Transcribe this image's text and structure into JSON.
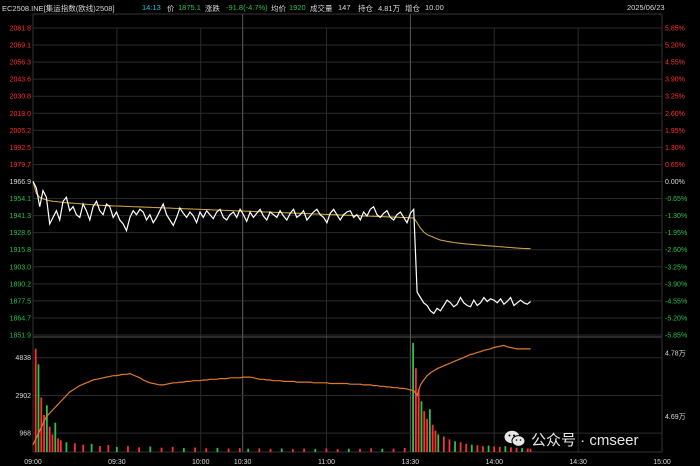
{
  "header": {
    "symbol": "EC2508.INE[集运指数(欧线)2508]",
    "time": "14:13",
    "price_label": "价",
    "price": "1875.1",
    "change_label": "涨跌",
    "change": "-91.8(-4.7%)",
    "avg_label": "均价",
    "avg": "1920",
    "volume_label": "成交量",
    "volume": "147",
    "oi_label": "持仓",
    "oi": "4.81万",
    "oi_chg_label": "增仓",
    "oi_chg": "10.00",
    "date": "2025/06/23"
  },
  "price_ticks": [
    "2081.8",
    "2069.1",
    "2056.3",
    "2043.6",
    "2030.8",
    "2018.0",
    "2005.2",
    "1992.5",
    "1979.7",
    "1966.9",
    "1954.1",
    "1941.3",
    "1928.6",
    "1915.8",
    "1903.0",
    "1890.2",
    "1877.5",
    "1864.7",
    "1851.9"
  ],
  "pct_ticks": [
    "5.85%",
    "5.20%",
    "4.55%",
    "3.90%",
    "3.25%",
    "2.60%",
    "1.95%",
    "1.30%",
    "0.65%",
    "0.00%",
    "-0.65%",
    "-1.30%",
    "-1.95%",
    "-2.60%",
    "-3.25%",
    "-3.90%",
    "-4.55%",
    "-5.20%",
    "-5.85%"
  ],
  "volume_ticks": [
    "4838",
    "2902",
    "968"
  ],
  "oi_ticks": [
    "4.78万",
    "4.69万"
  ],
  "time_ticks": [
    "09:00",
    "09:30",
    "10:00",
    "10:30",
    "11:00",
    "13:30",
    "14:00",
    "14:30",
    "15:00"
  ],
  "colors": {
    "up": "#ff3030",
    "down": "#27c24c",
    "flat": "#d8d8d8",
    "price_line": "#ffffff",
    "avg_line": "#c8a040",
    "oi_line": "#e07a2a",
    "grid": "#2a2a2a"
  },
  "chart_data": {
    "type": "line",
    "price_range": [
      1851.9,
      2081.8
    ],
    "prev_settle": 1966.9,
    "price_series": [
      1966.9,
      1962,
      1948,
      1960,
      1955,
      1935,
      1940,
      1945,
      1938,
      1952,
      1955,
      1945,
      1948,
      1942,
      1940,
      1950,
      1945,
      1938,
      1948,
      1952,
      1945,
      1942,
      1950,
      1948,
      1940,
      1944,
      1938,
      1935,
      1930,
      1940,
      1945,
      1942,
      1946,
      1944,
      1938,
      1942,
      1936,
      1940,
      1945,
      1950,
      1942,
      1938,
      1934,
      1940,
      1947,
      1943,
      1940,
      1944,
      1941,
      1936,
      1944,
      1940,
      1945,
      1942,
      1939,
      1944,
      1946,
      1940,
      1938,
      1942,
      1944,
      1940,
      1946,
      1942,
      1937,
      1944,
      1940,
      1943,
      1946,
      1941,
      1938,
      1944,
      1942,
      1940,
      1945,
      1941,
      1938,
      1943,
      1946,
      1940,
      1942,
      1945,
      1938,
      1941,
      1944,
      1946,
      1942,
      1940,
      1936,
      1943,
      1946,
      1942,
      1938,
      1942,
      1944,
      1945,
      1940,
      1942,
      1938,
      1944,
      1941,
      1946,
      1948,
      1942,
      1940,
      1943,
      1945,
      1940,
      1938,
      1942,
      1944,
      1940,
      1936,
      1943,
      1946,
      1884,
      1880,
      1876,
      1874,
      1870,
      1868,
      1872,
      1870,
      1874,
      1878,
      1876,
      1873,
      1875,
      1880,
      1876,
      1874,
      1873,
      1878,
      1874,
      1876,
      1880,
      1877,
      1879,
      1878,
      1876,
      1879,
      1875,
      1877,
      1880,
      1874,
      1876,
      1878,
      1876,
      1875,
      1877
    ],
    "avg_series": [
      1966.9,
      1958,
      1955,
      1954,
      1953,
      1952.5,
      1952,
      1951.8,
      1951.5,
      1951.2,
      1951,
      1950.8,
      1950.6,
      1950.4,
      1950.2,
      1950,
      1949.8,
      1949.6,
      1949.4,
      1949.2,
      1949,
      1948.9,
      1948.8,
      1948.7,
      1948.6,
      1948.5,
      1948.4,
      1948.3,
      1948.2,
      1948.1,
      1948,
      1947.9,
      1947.8,
      1947.7,
      1947.6,
      1947.5,
      1947.4,
      1947.3,
      1947.2,
      1947.1,
      1947,
      1946.9,
      1946.8,
      1946.7,
      1946.6,
      1946.5,
      1946.4,
      1946.3,
      1946.2,
      1946.1,
      1946,
      1945.9,
      1945.8,
      1945.7,
      1945.6,
      1945.5,
      1945.4,
      1945.3,
      1945.2,
      1945.1,
      1945,
      1944.9,
      1944.8,
      1944.7,
      1944.6,
      1944.5,
      1944.4,
      1944.3,
      1944.2,
      1944.1,
      1944,
      1943.9,
      1943.8,
      1943.7,
      1943.6,
      1943.5,
      1943.4,
      1943.3,
      1943.2,
      1943.1,
      1943,
      1942.9,
      1942.8,
      1942.7,
      1942.6,
      1942.5,
      1942.4,
      1942.3,
      1942.2,
      1942.1,
      1942,
      1941.9,
      1941.8,
      1941.7,
      1941.6,
      1941.5,
      1941.4,
      1941.3,
      1941.2,
      1941.1,
      1941,
      1940.9,
      1940.8,
      1940.7,
      1940.6,
      1940.5,
      1940.4,
      1940.3,
      1940.2,
      1940.1,
      1940,
      1939.9,
      1939.8,
      1939.7,
      1939.6,
      1936,
      1932,
      1929,
      1927,
      1926,
      1925,
      1924,
      1923,
      1922.5,
      1922,
      1921.6,
      1921.2,
      1920.9,
      1920.6,
      1920.3,
      1920,
      1919.8,
      1919.6,
      1919.4,
      1919.2,
      1919,
      1918.8,
      1918.6,
      1918.4,
      1918.2,
      1918,
      1917.8,
      1917.6,
      1917.4,
      1917.2,
      1917,
      1916.8,
      1916.7,
      1916.6,
      1916.5
    ],
    "volume_range": [
      0,
      5800
    ],
    "open_interest_series": [
      4.65,
      4.66,
      4.67,
      4.68,
      4.69,
      4.695,
      4.7,
      4.705,
      4.71,
      4.715,
      4.72,
      4.725,
      4.728,
      4.731,
      4.734,
      4.736,
      4.738,
      4.74,
      4.742,
      4.743,
      4.744,
      4.745,
      4.746,
      4.747,
      4.748,
      4.748,
      4.749,
      4.75,
      4.75,
      4.751,
      4.749,
      4.747,
      4.745,
      4.742,
      4.74,
      4.738,
      4.737,
      4.736,
      4.735,
      4.735,
      4.736,
      4.737,
      4.738,
      4.738,
      4.739,
      4.739,
      4.74,
      4.74,
      4.741,
      4.741,
      4.741,
      4.742,
      4.742,
      4.743,
      4.743,
      4.743,
      4.744,
      4.744,
      4.744,
      4.745,
      4.745,
      4.745,
      4.745,
      4.746,
      4.746,
      4.746,
      4.745,
      4.744,
      4.743,
      4.743,
      4.742,
      4.742,
      4.741,
      4.741,
      4.741,
      4.74,
      4.74,
      4.74,
      4.74,
      4.739,
      4.739,
      4.739,
      4.739,
      4.739,
      4.738,
      4.738,
      4.738,
      4.738,
      4.738,
      4.737,
      4.737,
      4.737,
      4.737,
      4.737,
      4.737,
      4.736,
      4.736,
      4.736,
      4.736,
      4.735,
      4.735,
      4.735,
      4.734,
      4.734,
      4.733,
      4.733,
      4.732,
      4.732,
      4.731,
      4.731,
      4.73,
      4.73,
      4.729,
      4.728,
      4.727,
      4.72,
      4.735,
      4.742,
      4.748,
      4.752,
      4.755,
      4.758,
      4.76,
      4.762,
      4.764,
      4.766,
      4.768,
      4.77,
      4.772,
      4.774,
      4.776,
      4.778,
      4.779,
      4.781,
      4.782,
      4.784,
      4.785,
      4.786,
      4.788,
      4.789,
      4.79,
      4.791,
      4.789,
      4.788,
      4.787,
      4.786,
      4.786,
      4.786,
      4.786,
      4.786
    ],
    "oi_range": [
      4.64,
      4.8
    ],
    "session_breaks": [
      "10:15",
      "11:30"
    ],
    "volume_bars": [
      {
        "t": "09:01",
        "v": 5300
      },
      {
        "t": "09:02",
        "v": 4500
      },
      {
        "t": "09:03",
        "v": 2800
      },
      {
        "t": "09:04",
        "v": 1900
      },
      {
        "t": "09:05",
        "v": 2400
      },
      {
        "t": "09:06",
        "v": 1300
      },
      {
        "t": "09:07",
        "v": 900
      },
      {
        "t": "09:08",
        "v": 1500
      },
      {
        "t": "09:09",
        "v": 700
      },
      {
        "t": "09:10",
        "v": 600
      },
      {
        "t": "09:12",
        "v": 500
      },
      {
        "t": "09:15",
        "v": 450
      },
      {
        "t": "09:18",
        "v": 380
      },
      {
        "t": "09:21",
        "v": 420
      },
      {
        "t": "09:24",
        "v": 300
      },
      {
        "t": "09:27",
        "v": 360
      },
      {
        "t": "09:30",
        "v": 260
      },
      {
        "t": "09:34",
        "v": 300
      },
      {
        "t": "09:38",
        "v": 240
      },
      {
        "t": "09:42",
        "v": 280
      },
      {
        "t": "09:46",
        "v": 220
      },
      {
        "t": "09:50",
        "v": 260
      },
      {
        "t": "09:54",
        "v": 200
      },
      {
        "t": "09:58",
        "v": 230
      },
      {
        "t": "10:02",
        "v": 190
      },
      {
        "t": "10:06",
        "v": 210
      },
      {
        "t": "10:10",
        "v": 180
      },
      {
        "t": "10:14",
        "v": 200
      },
      {
        "t": "10:32",
        "v": 170
      },
      {
        "t": "10:36",
        "v": 190
      },
      {
        "t": "10:40",
        "v": 160
      },
      {
        "t": "10:44",
        "v": 180
      },
      {
        "t": "10:48",
        "v": 150
      },
      {
        "t": "10:52",
        "v": 170
      },
      {
        "t": "10:56",
        "v": 160
      },
      {
        "t": "11:00",
        "v": 180
      },
      {
        "t": "11:04",
        "v": 150
      },
      {
        "t": "11:08",
        "v": 170
      },
      {
        "t": "11:12",
        "v": 160
      },
      {
        "t": "11:16",
        "v": 190
      },
      {
        "t": "11:20",
        "v": 170
      },
      {
        "t": "11:24",
        "v": 180
      },
      {
        "t": "11:28",
        "v": 210
      },
      {
        "t": "13:31",
        "v": 5600
      },
      {
        "t": "13:32",
        "v": 4300
      },
      {
        "t": "13:33",
        "v": 3200
      },
      {
        "t": "13:34",
        "v": 2600
      },
      {
        "t": "13:35",
        "v": 2100
      },
      {
        "t": "13:36",
        "v": 1700
      },
      {
        "t": "13:37",
        "v": 2200
      },
      {
        "t": "13:38",
        "v": 1400
      },
      {
        "t": "13:39",
        "v": 1100
      },
      {
        "t": "13:40",
        "v": 900
      },
      {
        "t": "13:42",
        "v": 800
      },
      {
        "t": "13:44",
        "v": 650
      },
      {
        "t": "13:46",
        "v": 550
      },
      {
        "t": "13:48",
        "v": 500
      },
      {
        "t": "13:50",
        "v": 420
      },
      {
        "t": "13:52",
        "v": 380
      },
      {
        "t": "13:54",
        "v": 350
      },
      {
        "t": "13:56",
        "v": 300
      },
      {
        "t": "13:58",
        "v": 330
      },
      {
        "t": "14:00",
        "v": 280
      },
      {
        "t": "14:02",
        "v": 260
      },
      {
        "t": "14:04",
        "v": 300
      },
      {
        "t": "14:06",
        "v": 240
      },
      {
        "t": "14:08",
        "v": 220
      },
      {
        "t": "14:10",
        "v": 200
      },
      {
        "t": "14:12",
        "v": 180
      },
      {
        "t": "14:13",
        "v": 160
      }
    ]
  },
  "watermark": {
    "text": "公众号 · cmseer"
  }
}
